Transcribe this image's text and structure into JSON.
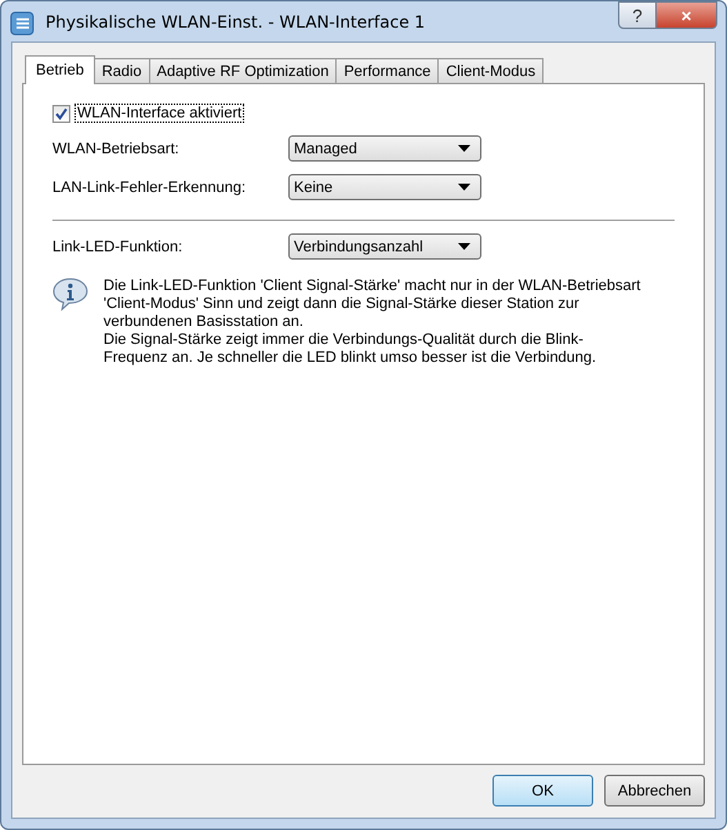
{
  "window": {
    "title": "Physikalische WLAN-Einst. - WLAN-Interface 1",
    "help_button": "?",
    "close_button": "×"
  },
  "tabs": [
    {
      "label": "Betrieb",
      "selected": true
    },
    {
      "label": "Radio",
      "selected": false
    },
    {
      "label": "Adaptive RF Optimization",
      "selected": false
    },
    {
      "label": "Performance",
      "selected": false
    },
    {
      "label": "Client-Modus",
      "selected": false
    }
  ],
  "enable_checkbox": {
    "label": "WLAN-Interface aktiviert",
    "checked": true
  },
  "settings": [
    {
      "label": "WLAN-Betriebsart:",
      "value": "Managed"
    },
    {
      "label": "LAN-Link-Fehler-Erkennung:",
      "value": "Keine"
    }
  ],
  "led_setting": {
    "label": "Link-LED-Funktion:",
    "value": "Verbindungsanzahl"
  },
  "info": [
    "Die Link-LED-Funktion 'Client Signal-Stärke' macht nur in der WLAN-Betriebsart 'Client-Modus' Sinn und zeigt dann die Signal-Stärke dieser Station zur verbundenen Basisstation an.",
    "Die Signal-Stärke zeigt immer die Verbindungs-Qualität durch die Blink-Frequenz an. Je schneller die LED blinkt umso besser ist die Verbindung."
  ],
  "buttons": [
    {
      "label": "OK",
      "default": true
    },
    {
      "label": "Abbrechen",
      "default": false
    }
  ]
}
